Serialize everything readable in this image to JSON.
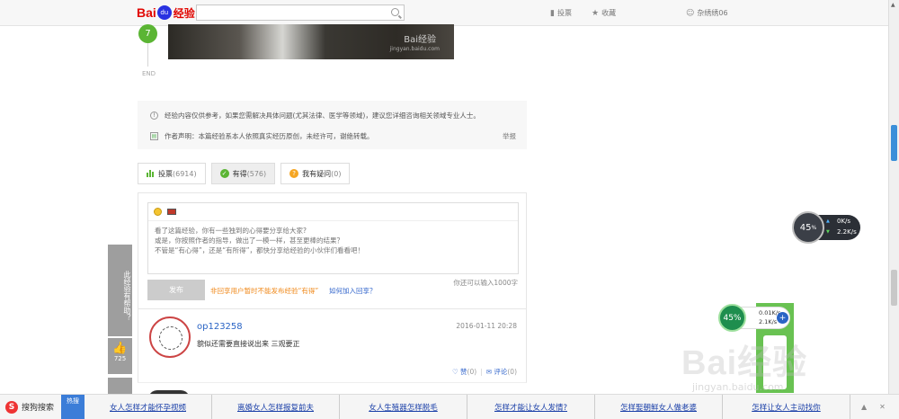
{
  "header": {
    "logo": {
      "left": "Bai",
      "mid": "du",
      "right": "经验"
    },
    "search": {
      "placeholder": "",
      "value": ""
    },
    "nav": {
      "vote": "投票",
      "favorite": "收藏",
      "user": "杂绣绣06"
    }
  },
  "step": {
    "number": "7",
    "end_label": "END",
    "photo_watermark": "Bai经验",
    "photo_watermark_url": "jingyan.baidu.com"
  },
  "notice": {
    "disclaimer": "经验内容仅供参考，如果您需解决具体问题(尤其法律、医学等领域)，建议您详细咨询相关领域专业人士。",
    "author_statement": "作者声明：本篇经验系本人依照真实经历原创，未经许可，谢绝转载。",
    "report": "举报"
  },
  "tabs": [
    {
      "label": "投票",
      "count": "(6914)"
    },
    {
      "label": "有得",
      "count": "(576)"
    },
    {
      "label": "我有疑问",
      "count": "(0)"
    }
  ],
  "composer": {
    "placeholder_lines": [
      "看了这篇经验，你有一些独到的心得要分享给大家?",
      "或是，你按照作者的指导，做出了一模一样，甚至更棒的结果？",
      "不管是“有心得”，还是“有所得”，都快分享给经验的小伙伴们看看吧！"
    ],
    "limit": "你还可以输入1000字",
    "post_button": "发布",
    "warning": "非回享用户暂时不能发布经验“有得”",
    "join_link": "如何加入回享？"
  },
  "comments": [
    {
      "user": "op123258",
      "date": "2016-01-11 20:28",
      "text": "貌似还需要直接说出来 三观要正",
      "like_label": "赞",
      "like_count": "(0)",
      "reply_label": "评论",
      "reply_count": "(0)"
    }
  ],
  "side": {
    "helpful": "此经验有帮助？",
    "like_count": "725"
  },
  "speed_widget_1": {
    "percent": "45",
    "up": "0K/s",
    "down": "2.2K/s"
  },
  "speed_widget_2": {
    "percent": "45%",
    "up": "0.01K/s",
    "down": "2.1K/s",
    "plus": "+"
  },
  "watermark": {
    "big": "Bai经验",
    "url": "jingyan.baidu.com"
  },
  "hotbar": {
    "brand": "搜狗搜索",
    "badge": "热搜",
    "links": [
      "女人怎样才能怀孕视频",
      "离婚女人怎样报复前夫",
      "女人生殖器怎样脱毛",
      "怎样才能让女人发情?",
      "怎样娶朝鲜女人做老婆",
      "怎样让女人主动找你"
    ]
  },
  "colors": {
    "green": "#5bb534",
    "blue_link": "#3366cc",
    "logo_red": "#e10601",
    "hot_blue": "#3b7dd8"
  }
}
